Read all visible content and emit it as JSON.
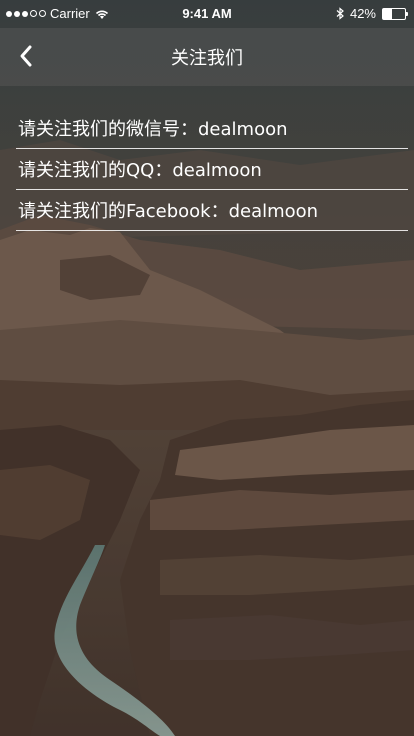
{
  "status_bar": {
    "carrier": "Carrier",
    "time": "9:41 AM",
    "battery_percent": "42%",
    "battery_level": 0.42,
    "signal_icon": "signal-dots-icon",
    "wifi_icon": "wifi-icon",
    "bluetooth_icon": "bluetooth-icon",
    "battery_icon": "battery-icon"
  },
  "nav": {
    "title": "关注我们",
    "back_icon": "chevron-left-icon"
  },
  "follow_list": [
    {
      "label": "请关注我们的微信号：dealmoon"
    },
    {
      "label": "请关注我们的QQ：dealmoon"
    },
    {
      "label": "请关注我们的Facebook：dealmoon"
    }
  ]
}
